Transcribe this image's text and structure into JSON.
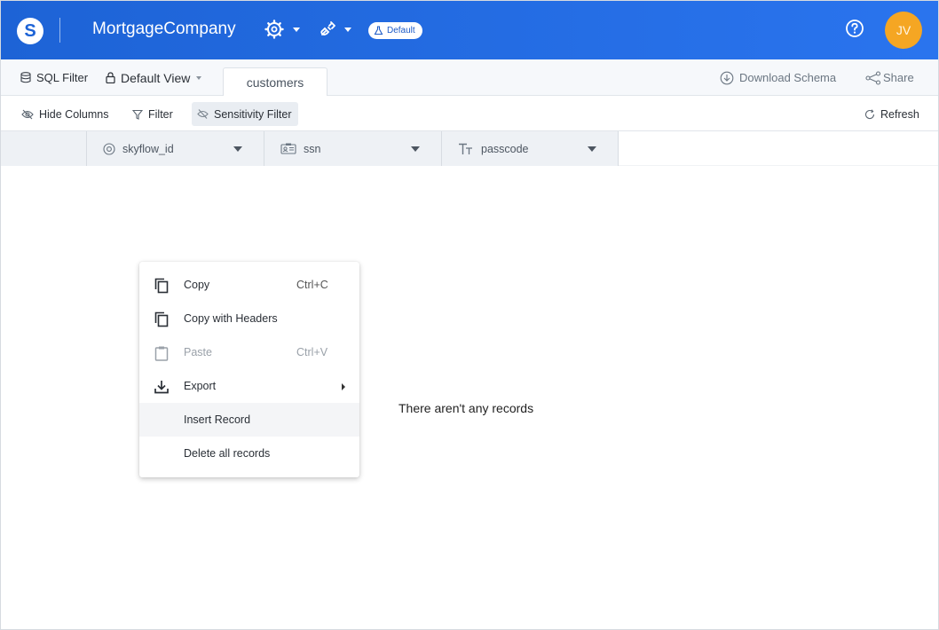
{
  "header": {
    "logo_letter": "S",
    "app_title": "MortgageCompany",
    "env_badge": "Default",
    "avatar_initials": "JV",
    "brand_color": "#1d63d6",
    "avatar_color": "#f5a623"
  },
  "tabs": {
    "sql_filter": "SQL Filter",
    "view_selector": "Default View",
    "active_tab": "customers",
    "download_schema": "Download Schema",
    "share": "Share"
  },
  "toolbar": {
    "hide_columns": "Hide Columns",
    "filter": "Filter",
    "sensitivity_filter": "Sensitivity Filter",
    "refresh": "Refresh"
  },
  "columns": [
    {
      "label": "skyflow_id",
      "icon": "id-icon"
    },
    {
      "label": "ssn",
      "icon": "id-card-icon"
    },
    {
      "label": "passcode",
      "icon": "text-type-icon"
    }
  ],
  "empty_message": "There aren't any records",
  "context_menu": {
    "items": [
      {
        "label": "Copy",
        "shortcut": "Ctrl+C",
        "icon": "copy-icon",
        "enabled": true
      },
      {
        "label": "Copy with Headers",
        "shortcut": "",
        "icon": "copy-icon",
        "enabled": true
      },
      {
        "label": "Paste",
        "shortcut": "Ctrl+V",
        "icon": "clipboard-icon",
        "enabled": false
      },
      {
        "label": "Export",
        "shortcut": "",
        "icon": "download-icon",
        "enabled": true,
        "submenu": true
      },
      {
        "label": "Insert Record",
        "shortcut": "",
        "icon": "",
        "enabled": true,
        "hovered": true
      },
      {
        "label": "Delete all records",
        "shortcut": "",
        "icon": "",
        "enabled": true
      }
    ]
  }
}
